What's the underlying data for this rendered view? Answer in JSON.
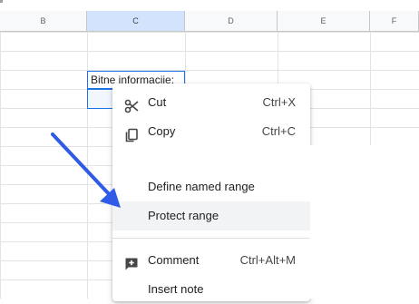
{
  "columns": [
    {
      "letter": "B"
    },
    {
      "letter": "C"
    },
    {
      "letter": "D"
    },
    {
      "letter": "E"
    },
    {
      "letter": "F"
    }
  ],
  "selected_column": "C",
  "active_cell": {
    "value": "Bitne informacije:"
  },
  "context_menu": {
    "items": [
      {
        "label": "Cut",
        "shortcut": "Ctrl+X",
        "icon": "scissors-icon"
      },
      {
        "label": "Copy",
        "shortcut": "Ctrl+C",
        "icon": "copy-icon"
      },
      {
        "label": "Define named range",
        "shortcut": ""
      },
      {
        "label": "Protect range",
        "shortcut": "",
        "highlighted": true
      },
      {
        "label": "Comment",
        "shortcut": "Ctrl+Alt+M",
        "icon": "comment-add-icon"
      },
      {
        "label": "Insert note",
        "shortcut": ""
      }
    ]
  },
  "annotation": {
    "arrow_color": "#2f5be7",
    "arrow_target": "Protect range"
  },
  "colors": {
    "selection": "#1a73e8",
    "header_bg": "#f8f9fa",
    "highlight": "#f1f3f4"
  }
}
